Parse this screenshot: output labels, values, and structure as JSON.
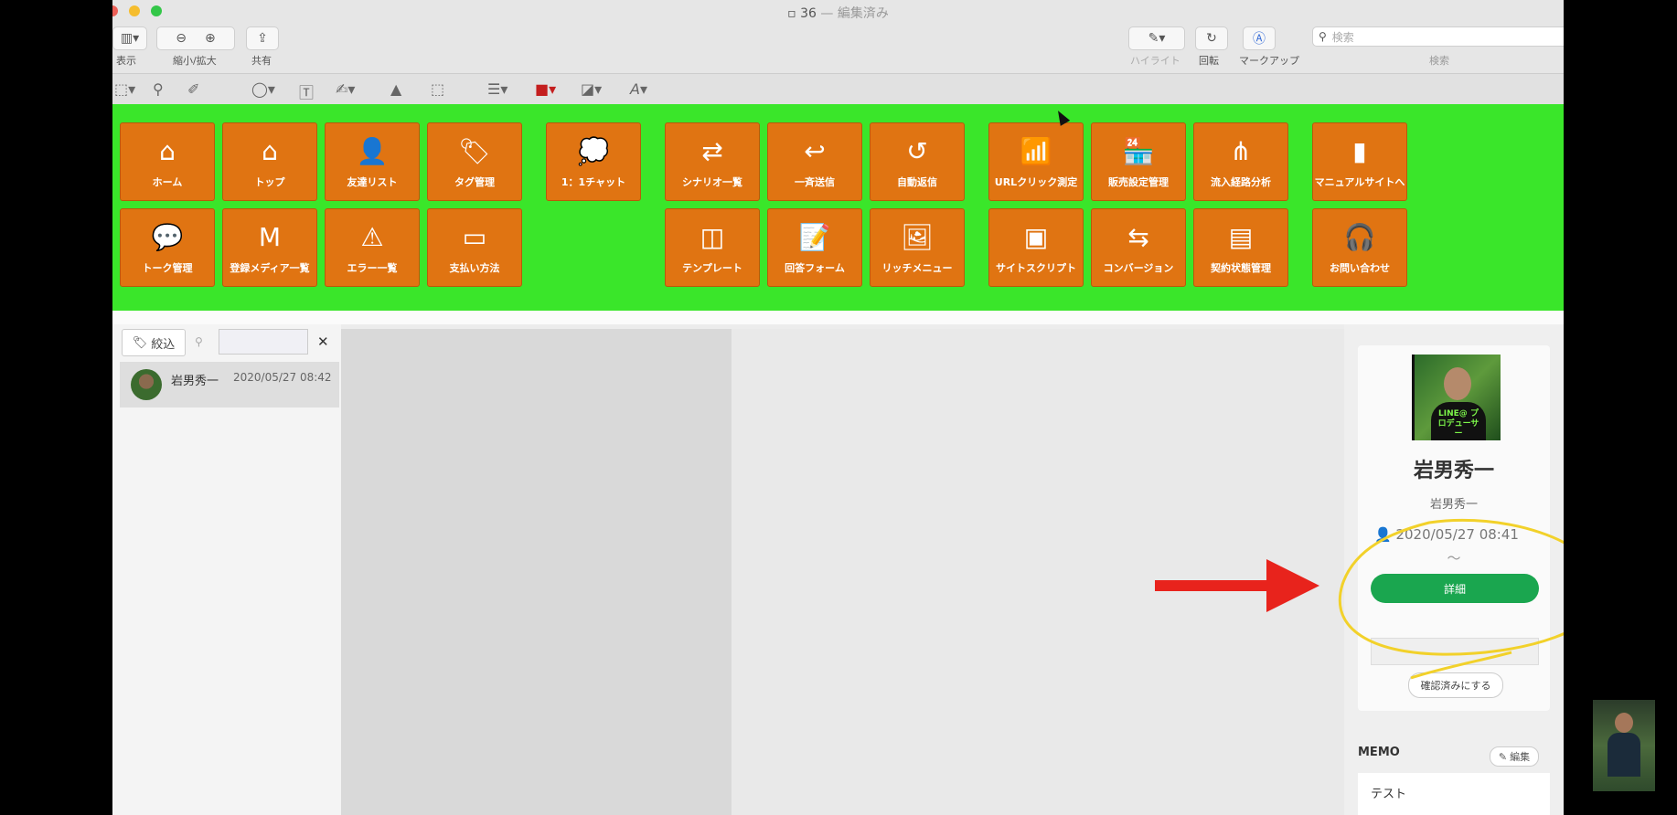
{
  "window": {
    "title_number": "36",
    "title_status": "— 編集済み",
    "toolbar": {
      "view_label": "表示",
      "zoom_label": "縮小/拡大",
      "share_label": "共有",
      "highlight_label": "ハイライト",
      "rotate_label": "回転",
      "markup_label": "マークアップ",
      "search_placeholder": "検索",
      "search_label": "検索"
    }
  },
  "nav": {
    "group1_row1": [
      {
        "label": "ホーム",
        "icon": "home-icon"
      },
      {
        "label": "トップ",
        "icon": "home-icon"
      },
      {
        "label": "友達リスト",
        "icon": "user-icon"
      },
      {
        "label": "タグ管理",
        "icon": "tags-icon"
      }
    ],
    "group1_row2": [
      {
        "label": "トーク管理",
        "icon": "chat-bubble-icon"
      },
      {
        "label": "登録メディア一覧",
        "icon": "media-icon"
      },
      {
        "label": "エラー一覧",
        "icon": "warning-icon"
      },
      {
        "label": "支払い方法",
        "icon": "card-icon"
      }
    ],
    "chat": {
      "label": "1：1チャット",
      "icon": "comment-dots-icon"
    },
    "group2_row1": [
      {
        "label": "シナリオ一覧",
        "icon": "shuffle-icon"
      },
      {
        "label": "一斉送信",
        "icon": "reply-icon"
      },
      {
        "label": "自動返信",
        "icon": "undo-icon"
      }
    ],
    "group2_row2": [
      {
        "label": "テンプレート",
        "icon": "columns-icon"
      },
      {
        "label": "回答フォーム",
        "icon": "form-icon"
      },
      {
        "label": "リッチメニュー",
        "icon": "image-icon"
      }
    ],
    "group3_row1": [
      {
        "label": "URLクリック測定",
        "icon": "chart-click-icon"
      },
      {
        "label": "販売設定管理",
        "icon": "store-icon"
      },
      {
        "label": "流入経路分析",
        "icon": "sitemap-icon"
      }
    ],
    "group3_row2": [
      {
        "label": "サイトスクリプト",
        "icon": "www-icon"
      },
      {
        "label": "コンバージョン",
        "icon": "exchange-icon"
      },
      {
        "label": "契約状態管理",
        "icon": "list-box-icon"
      }
    ],
    "manual": {
      "label": "マニュアルサイトへ",
      "icon": "book-icon"
    },
    "contact": {
      "label": "お問い合わせ",
      "icon": "headset-icon"
    }
  },
  "left": {
    "filter_label": "絞込",
    "friend": {
      "name": "岩男秀一",
      "date": "2020/05/27 08:42"
    }
  },
  "profile": {
    "photo_caption": "LINE@ プロデューサー",
    "name": "岩男秀一",
    "sub": "岩男秀一",
    "date": "2020/05/27 08:41",
    "tilde": "〜",
    "detail_label": "詳細",
    "confirm_label": "確認済みにする"
  },
  "memo": {
    "heading": "MEMO",
    "edit_label": "編集",
    "text": "テスト"
  },
  "colors": {
    "nav_bg": "#3ae62a",
    "tile": "#e07412",
    "detail_button": "#1aa64f",
    "annotation_arrow": "#e8231c",
    "annotation_circle": "#f2d12a"
  }
}
